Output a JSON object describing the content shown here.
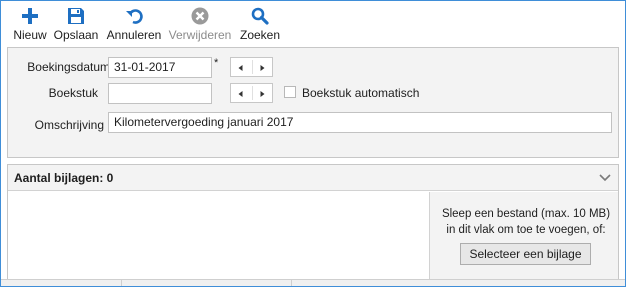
{
  "toolbar": {
    "new": {
      "label": "Nieuw",
      "icon": "plus-icon",
      "color": "#1e6fc2"
    },
    "save": {
      "label": "Opslaan",
      "icon": "floppy-disk-icon",
      "color": "#1e6fc2"
    },
    "cancel": {
      "label": "Annuleren",
      "icon": "undo-icon",
      "color": "#1e6fc2"
    },
    "delete": {
      "label": "Verwijderen",
      "icon": "delete-circle-icon",
      "color": "#9a9a9a",
      "disabled": true
    },
    "search": {
      "label": "Zoeken",
      "icon": "magnifier-icon",
      "color": "#1e6fc2"
    }
  },
  "form": {
    "booking_date": {
      "label": "Boekingsdatum",
      "value": "31-01-2017",
      "required_marker": "*"
    },
    "document": {
      "label": "Boekstuk",
      "value": ""
    },
    "auto_document": {
      "label": "Boekstuk automatisch",
      "checked": false
    },
    "description": {
      "label": "Omschrijving",
      "value": "Kilometervergoeding januari 2017"
    }
  },
  "attachments": {
    "title": "Aantal bijlagen: 0",
    "drop_text": "Sleep een bestand (max. 10 MB) in dit vlak om toe te voegen, of:",
    "select_button": "Selecteer een bijlage"
  },
  "colors": {
    "accent": "#1e6fc2",
    "window_border": "#3f8ed8",
    "panel_bg": "#f3f3f3"
  }
}
